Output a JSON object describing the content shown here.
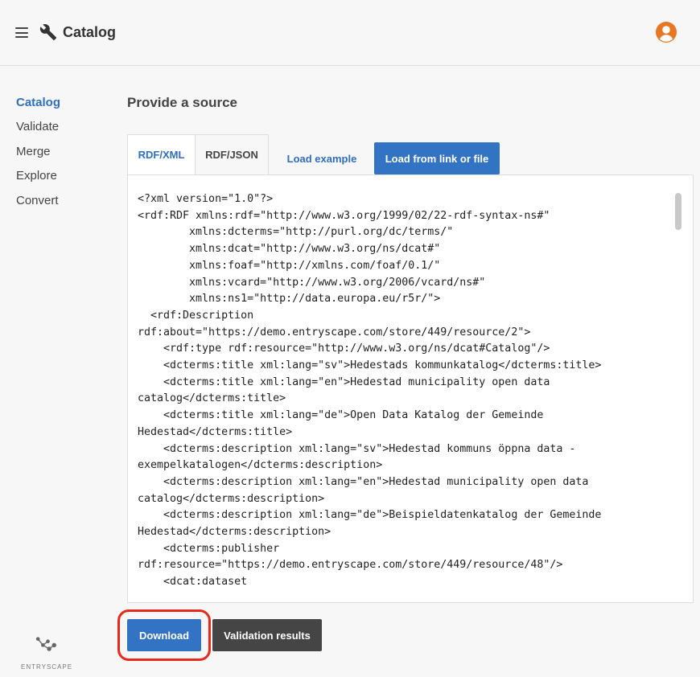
{
  "header": {
    "app_title": "Catalog",
    "icons": [
      "menu-icon",
      "wrench-icon",
      "user-avatar-icon"
    ],
    "accent_color": "#e87722"
  },
  "sidebar": {
    "items": [
      {
        "label": "Catalog",
        "active": true
      },
      {
        "label": "Validate",
        "active": false
      },
      {
        "label": "Merge",
        "active": false
      },
      {
        "label": "Explore",
        "active": false
      },
      {
        "label": "Convert",
        "active": false
      }
    ],
    "logo_text": "ENTRYSCAPE"
  },
  "main": {
    "section_title": "Provide a source",
    "tabs": [
      {
        "label": "RDF/XML",
        "active": true
      },
      {
        "label": "RDF/JSON",
        "active": false
      }
    ],
    "load_example_label": "Load example",
    "load_link_label": "Load from link or file",
    "editor_lines": [
      "<?xml version=\"1.0\"?>",
      "<rdf:RDF xmlns:rdf=\"http://www.w3.org/1999/02/22-rdf-syntax-ns#\"",
      "        xmlns:dcterms=\"http://purl.org/dc/terms/\"",
      "        xmlns:dcat=\"http://www.w3.org/ns/dcat#\"",
      "        xmlns:foaf=\"http://xmlns.com/foaf/0.1/\"",
      "        xmlns:vcard=\"http://www.w3.org/2006/vcard/ns#\"",
      "        xmlns:ns1=\"http://data.europa.eu/r5r/\">",
      "  <rdf:Description",
      "rdf:about=\"https://demo.entryscape.com/store/449/resource/2\">",
      "    <rdf:type rdf:resource=\"http://www.w3.org/ns/dcat#Catalog\"/>",
      "    <dcterms:title xml:lang=\"sv\">Hedestads kommunkatalog</dcterms:title>",
      "    <dcterms:title xml:lang=\"en\">Hedestad municipality open data",
      "catalog</dcterms:title>",
      "    <dcterms:title xml:lang=\"de\">Open Data Katalog der Gemeinde",
      "Hedestad</dcterms:title>",
      "    <dcterms:description xml:lang=\"sv\">Hedestad kommuns öppna data -",
      "exempelkatalogen</dcterms:description>",
      "    <dcterms:description xml:lang=\"en\">Hedestad municipality open data",
      "catalog</dcterms:description>",
      "    <dcterms:description xml:lang=\"de\">Beispieldatenkatalog der Gemeinde",
      "Hedestad</dcterms:description>",
      "    <dcterms:publisher",
      "rdf:resource=\"https://demo.entryscape.com/store/449/resource/48\"/>",
      "    <dcat:dataset"
    ],
    "download_label": "Download",
    "validation_label": "Validation results",
    "primary_color": "#3373c4"
  }
}
